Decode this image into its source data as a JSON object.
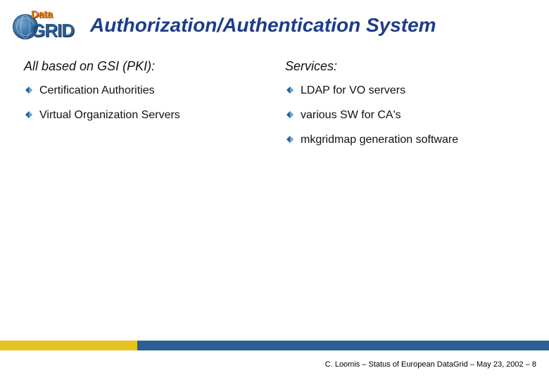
{
  "logo": {
    "top": "Data",
    "bottom": "GRID"
  },
  "title": "Authorization/Authentication System",
  "left": {
    "heading": "All based on GSI (PKI):",
    "items": [
      "Certification Authorities",
      "Virtual Organization Servers"
    ]
  },
  "right": {
    "heading": "Services:",
    "items": [
      "LDAP for VO servers",
      "various SW for CA's",
      "mkgridmap generation software"
    ]
  },
  "footer": "C. Loomis – Status of European DataGrid – May 23, 2002 – 8"
}
